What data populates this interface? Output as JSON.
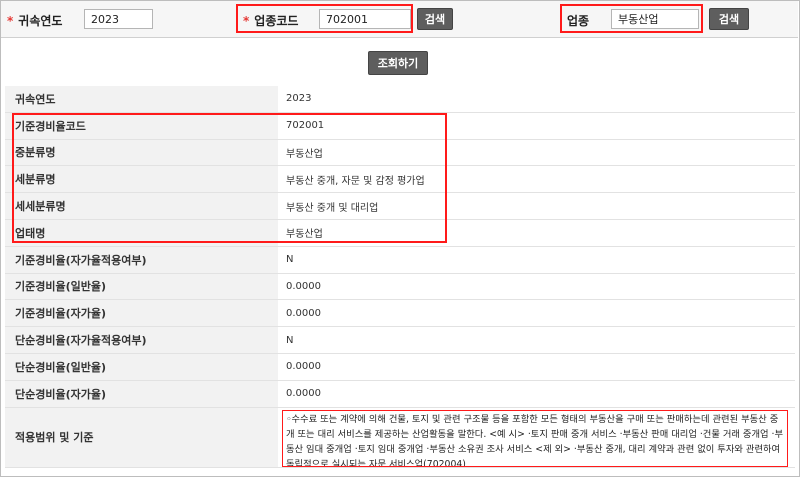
{
  "search": {
    "year_label": "귀속연도",
    "year_value": "2023",
    "code_label": "업종코드",
    "code_value": "702001",
    "code_search_button": "검색",
    "industry_label": "업종",
    "industry_value": "부동산업",
    "industry_search_button": "검색",
    "required_mark": "*"
  },
  "query_button": "조회하기",
  "rows": [
    {
      "label": "귀속연도",
      "value": "2023"
    },
    {
      "label": "기준경비율코드",
      "value": "702001"
    },
    {
      "label": "중분류명",
      "value": "부동산업"
    },
    {
      "label": "세분류명",
      "value": "부동산 중개, 자문 및 감정 평가업"
    },
    {
      "label": "세세분류명",
      "value": "부동산 중개 및 대리업"
    },
    {
      "label": "업태명",
      "value": "부동산업"
    },
    {
      "label": "기준경비율(자가율적용여부)",
      "value": "N"
    },
    {
      "label": "기준경비율(일반율)",
      "value": "0.0000"
    },
    {
      "label": "기준경비율(자가율)",
      "value": "0.0000"
    },
    {
      "label": "단순경비율(자가율적용여부)",
      "value": "N"
    },
    {
      "label": "단순경비율(일반율)",
      "value": "0.0000"
    },
    {
      "label": "단순경비율(자가율)",
      "value": "0.0000"
    }
  ],
  "scope": {
    "label": "적용범위 및 기준",
    "text": "◦수수료 또는 계약에 의해 건물, 토지 및 관련 구조물 등을 포함한 모든 형태의 부동산을 구매 또는 판매하는데 관련된 부동산 중개 또는 대리 서비스를 제공하는 산업활동을 말한다. <예 시> ·토지 판매 중개 서비스 ·부동산 판매 대리업 ·건물 거래 중개업 ·부동산 임대 중개업 ·토지 임대 중개업 ·부동산 소유권 조사 서비스 <제 외> ·부동산 중개, 대리 계약과 관련 없이 투자와 관련하여 독립적으로 실시되는 자문 서비스업(702004)"
  },
  "colors": {
    "highlight": "#ff1a1a",
    "button": "#5e5e5e",
    "label_bg": "#f2f2f2"
  }
}
